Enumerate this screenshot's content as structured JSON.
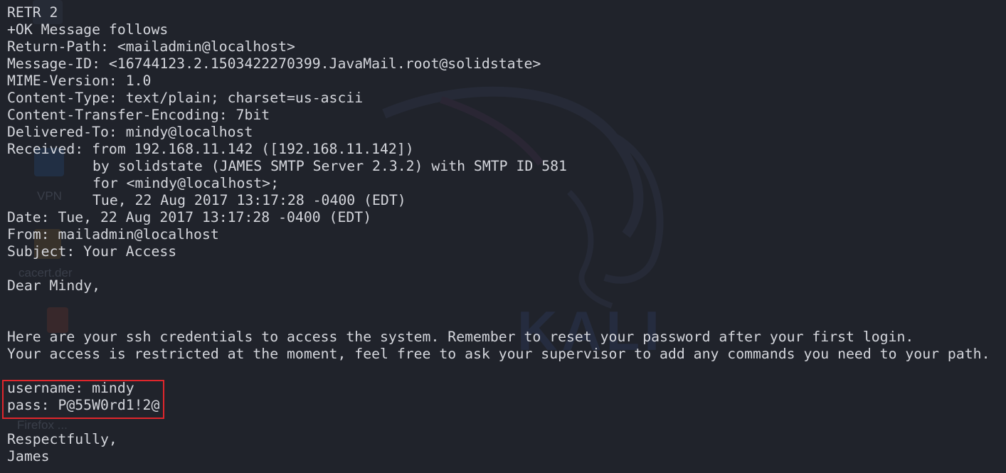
{
  "terminal": {
    "lines": {
      "l01": "RETR 2",
      "l02": "+OK Message follows",
      "l03": "Return-Path: <mailadmin@localhost>",
      "l04": "Message-ID: <16744123.2.1503422270399.JavaMail.root@solidstate>",
      "l05": "MIME-Version: 1.0",
      "l06": "Content-Type: text/plain; charset=us-ascii",
      "l07": "Content-Transfer-Encoding: 7bit",
      "l08": "Delivered-To: mindy@localhost",
      "l09": "Received: from 192.168.11.142 ([192.168.11.142])",
      "l10": "by solidstate (JAMES SMTP Server 2.3.2) with SMTP ID 581",
      "l11": "for <mindy@localhost>;",
      "l12": "Tue, 22 Aug 2017 13:17:28 -0400 (EDT)",
      "l13": "Date: Tue, 22 Aug 2017 13:17:28 -0400 (EDT)",
      "l14": "From: mailadmin@localhost",
      "l15": "Subject: Your Access",
      "l16": "",
      "l17": "Dear Mindy,",
      "l18": "",
      "l19": "",
      "l20": "Here are your ssh credentials to access the system. Remember to reset your password after your first login.",
      "l21": "Your access is restricted at the moment, feel free to ask your supervisor to add any commands you need to your path.",
      "l22": "",
      "l23": "username: mindy",
      "l24": "pass: P@55W0rd1!2@",
      "l25": "",
      "l26": "Respectfully,",
      "l27": "James"
    }
  },
  "desktop_background": {
    "labels": [
      "VPN",
      "cacert.der",
      "Firefox ..."
    ],
    "watermark": "KALI"
  },
  "colors": {
    "background": "#20232b",
    "text": "#d4d6dc",
    "highlight_border": "#e0262c"
  }
}
